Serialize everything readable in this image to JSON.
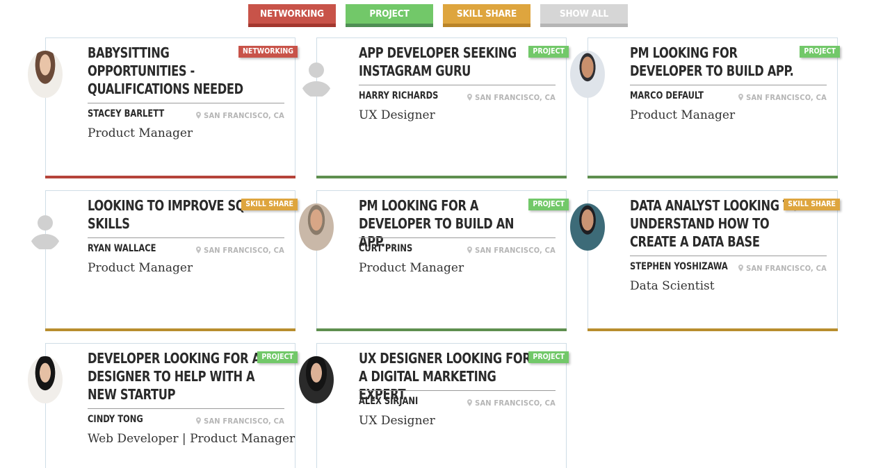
{
  "filters": [
    {
      "label": "NETWORKING",
      "color": "#c85349"
    },
    {
      "label": "PROJECT",
      "color": "#72c869"
    },
    {
      "label": "SKILL SHARE",
      "color": "#dea53e"
    },
    {
      "label": "SHOW ALL",
      "color": "#d6d6d6"
    }
  ],
  "cards": [
    {
      "title": "BABYSITTING OPPORTUNITIES - QUALIFICATIONS NEEDED",
      "tag": "NETWORKING",
      "name": "STACEY BARLETT",
      "location": "SAN FRANCISCO, CA",
      "role": "Product Manager",
      "avatar": "photo"
    },
    {
      "title": "APP DEVELOPER SEEKING INSTAGRAM GURU",
      "tag": "PROJECT",
      "name": "HARRY RICHARDS",
      "location": "SAN FRANCISCO, CA",
      "role": "UX Designer",
      "avatar": "placeholder-user-icon"
    },
    {
      "title": "PM LOOKING FOR DEVELOPER TO BUILD APP.",
      "tag": "PROJECT",
      "name": "MARCO DEFAULT",
      "location": "SAN FRANCISCO, CA",
      "role": "Product Manager",
      "avatar": "photo"
    },
    {
      "title": "LOOKING TO IMPROVE SQL SKILLS",
      "tag": "SKILL SHARE",
      "name": "RYAN WALLACE",
      "location": "SAN FRANCISCO, CA",
      "role": "Product Manager",
      "avatar": "placeholder-user-icon"
    },
    {
      "title": "PM LOOKING FOR A DEVELOPER TO BUILD AN APP.",
      "tag": "PROJECT",
      "name": "CURT PRINS",
      "location": "SAN FRANCISCO, CA",
      "role": "Product Manager",
      "avatar": "photo"
    },
    {
      "title": "DATA ANALYST LOOKING TO UNDERSTAND HOW TO CREATE A DATA BASE",
      "tag": "SKILL SHARE",
      "name": "STEPHEN YOSHIZAWA",
      "location": "SAN FRANCISCO, CA",
      "role": "Data Scientist",
      "avatar": "photo"
    },
    {
      "title": "DEVELOPER LOOKING FOR A DESIGNER TO HELP WITH A NEW STARTUP",
      "tag": "PROJECT",
      "name": "CINDY TONG",
      "location": "SAN FRANCISCO, CA",
      "role": "Web Developer | Product Manager",
      "avatar": "photo"
    },
    {
      "title": "UX DESIGNER LOOKING FOR A DIGITAL MARKETING EXPERT",
      "tag": "PROJECT",
      "name": "ALEX SIRJANI",
      "location": "SAN FRANCISCO, CA",
      "role": "UX Designer",
      "avatar": "photo"
    }
  ],
  "colors": {
    "networking": "#c85349",
    "project": "#72c869",
    "skill_share": "#dea53e",
    "show_all": "#d6d6d6",
    "bar_networking": "#b5443a",
    "bar_project": "#5e8f4f",
    "bar_skill_share": "#b88e2e"
  }
}
